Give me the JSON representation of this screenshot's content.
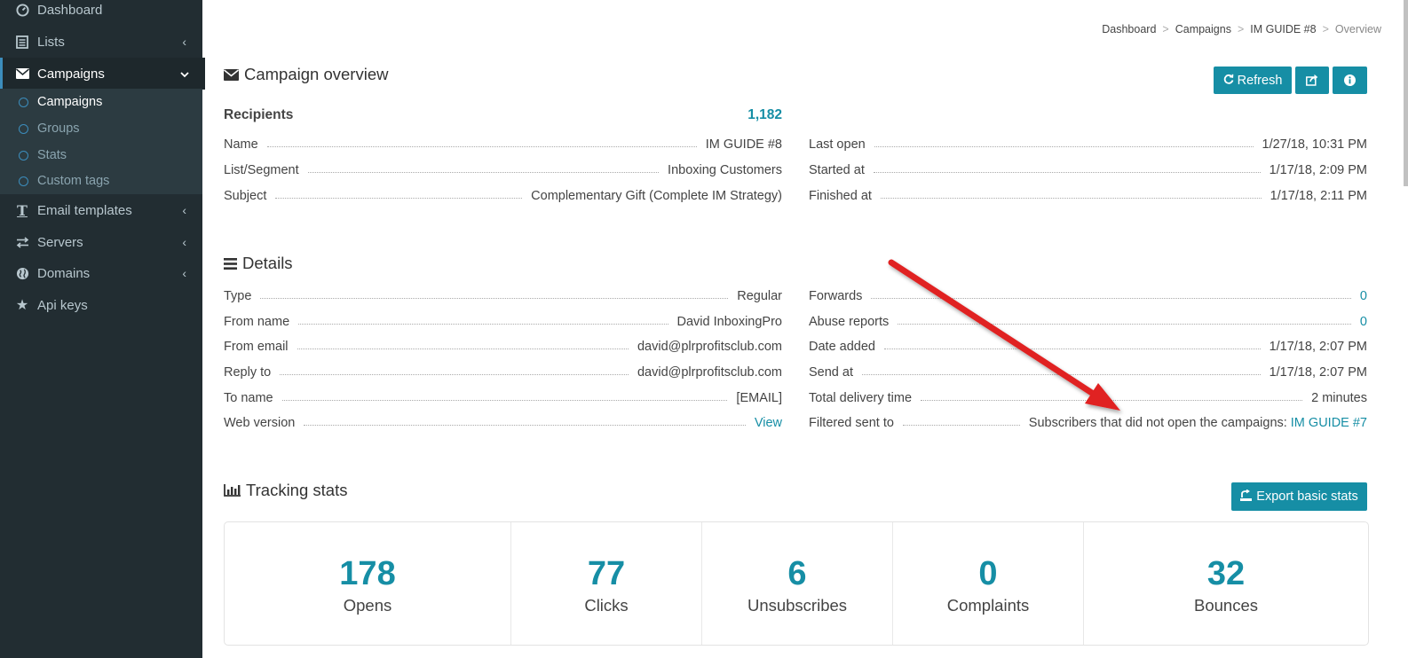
{
  "sidebar": {
    "items": [
      {
        "label": "Dashboard",
        "icon": "dashboard-icon"
      },
      {
        "label": "Lists",
        "icon": "list-icon"
      },
      {
        "label": "Campaigns",
        "icon": "envelope-icon"
      },
      {
        "label": "Email templates",
        "icon": "text-icon"
      },
      {
        "label": "Servers",
        "icon": "exchange-icon"
      },
      {
        "label": "Domains",
        "icon": "globe-icon"
      },
      {
        "label": "Api keys",
        "icon": "star-icon"
      }
    ],
    "subitems": [
      {
        "label": "Campaigns"
      },
      {
        "label": "Groups"
      },
      {
        "label": "Stats"
      },
      {
        "label": "Custom tags"
      }
    ]
  },
  "breadcrumb": {
    "items": [
      "Dashboard",
      "Campaigns",
      "IM GUIDE #8"
    ],
    "current": "Overview",
    "separator": ">"
  },
  "overview": {
    "title": "Campaign overview",
    "refresh_label": "Refresh",
    "recipients_label": "Recipients",
    "recipients_value": "1,182",
    "left": [
      {
        "k": "Name",
        "v": "IM GUIDE #8"
      },
      {
        "k": "List/Segment",
        "v": "Inboxing Customers"
      },
      {
        "k": "Subject",
        "v": "Complementary Gift (Complete IM Strategy)"
      }
    ],
    "right": [
      {
        "k": "Last open",
        "v": "1/27/18, 10:31 PM"
      },
      {
        "k": "Started at",
        "v": "1/17/18, 2:09 PM"
      },
      {
        "k": "Finished at",
        "v": "1/17/18, 2:11 PM"
      }
    ]
  },
  "details": {
    "title": "Details",
    "left": [
      {
        "k": "Type",
        "v": "Regular"
      },
      {
        "k": "From name",
        "v": "David InboxingPro"
      },
      {
        "k": "From email",
        "v": "david@plrprofitsclub.com"
      },
      {
        "k": "Reply to",
        "v": "david@plrprofitsclub.com"
      },
      {
        "k": "To name",
        "v": "[EMAIL]"
      },
      {
        "k": "Web version",
        "v": "View"
      }
    ],
    "right": [
      {
        "k": "Forwards",
        "v": "0"
      },
      {
        "k": "Abuse reports",
        "v": "0"
      },
      {
        "k": "Date added",
        "v": "1/17/18, 2:07 PM"
      },
      {
        "k": "Send at",
        "v": "1/17/18, 2:07 PM"
      },
      {
        "k": "Total delivery time",
        "v": "2 minutes"
      },
      {
        "k": "Filtered sent to",
        "v": "Subscribers that did not open the campaigns:",
        "link": "IM GUIDE #7"
      }
    ]
  },
  "tracking": {
    "title": "Tracking stats",
    "export_label": "Export basic stats",
    "stats": [
      {
        "num": "178",
        "label": "Opens"
      },
      {
        "num": "77",
        "label": "Clicks"
      },
      {
        "num": "6",
        "label": "Unsubscribes"
      },
      {
        "num": "0",
        "label": "Complaints"
      },
      {
        "num": "32",
        "label": "Bounces"
      }
    ]
  },
  "colors": {
    "sidebar_bg": "#222d32",
    "accent": "#168ea5",
    "arrow": "#e02020"
  }
}
